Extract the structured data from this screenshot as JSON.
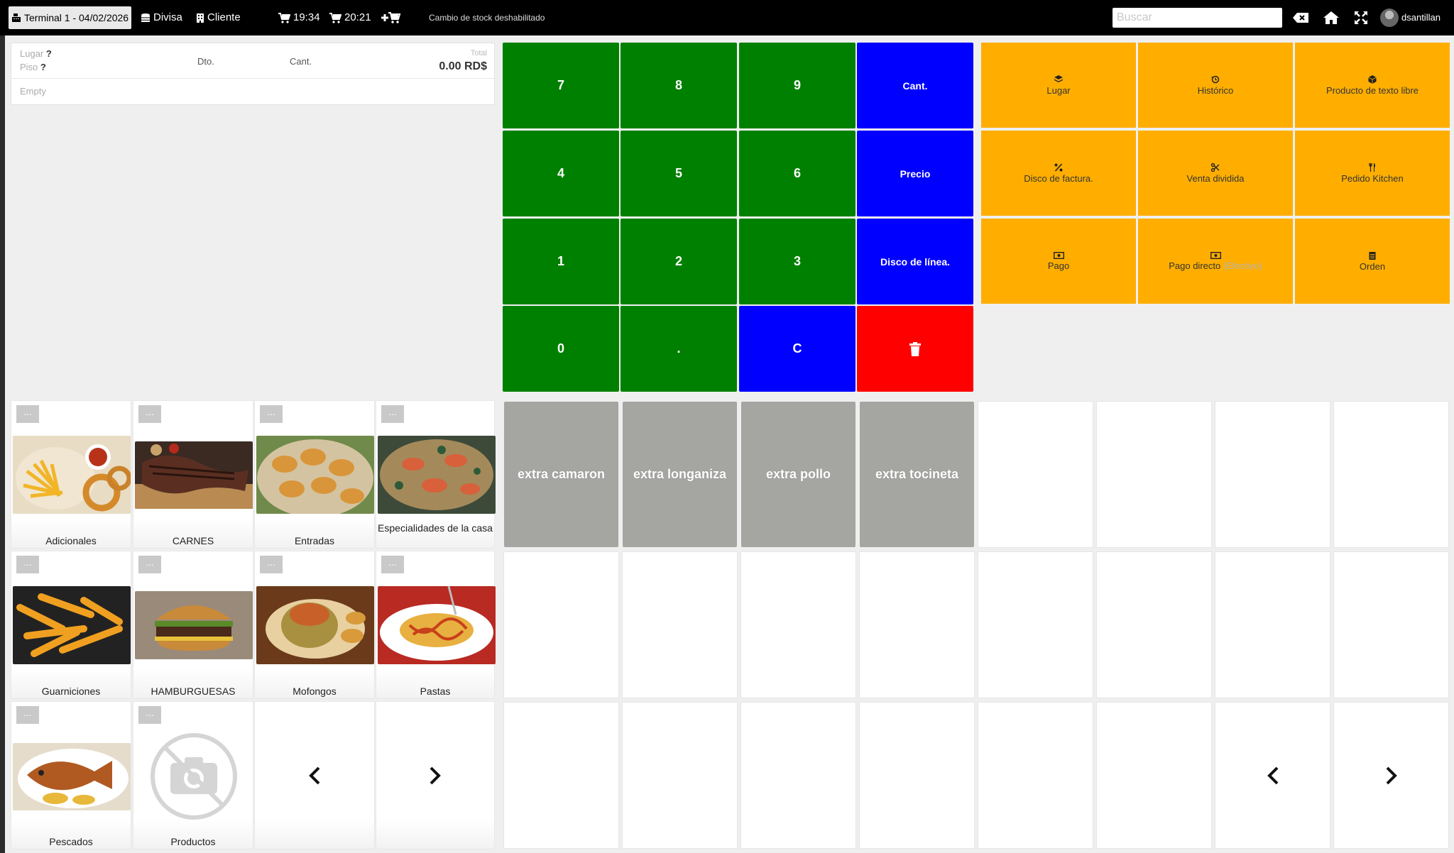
{
  "topbar": {
    "terminal": "Terminal 1 - 04/02/2026",
    "currency": "Divisa",
    "customer": "Cliente",
    "cart1_time": "19:34",
    "cart2_time": "20:21",
    "stock_note": "Cambio de stock deshabilitado",
    "search_placeholder": "Buscar",
    "username": "dsantillan"
  },
  "ticket": {
    "place_label": "Lugar",
    "place_value": "?",
    "floor_label": "Piso",
    "floor_value": "?",
    "discount_header": "Dto.",
    "qty_header": "Cant.",
    "total_label": "Total",
    "total_value": "0.00 RD$",
    "empty_text": "Empty"
  },
  "numpad": {
    "keys": [
      "7",
      "8",
      "9",
      "4",
      "5",
      "6",
      "1",
      "2",
      "3",
      "0",
      ".",
      "C"
    ],
    "qty_label": "Cant.",
    "price_label": "Precio",
    "line_discount_label": "Disco de línea."
  },
  "actions": [
    {
      "icon": "layers-icon",
      "label": "Lugar"
    },
    {
      "icon": "history-icon",
      "label": "Histórico"
    },
    {
      "icon": "cube-icon",
      "label": "Producto de texto libre"
    },
    {
      "icon": "percent-icon",
      "label": "Disco de factura."
    },
    {
      "icon": "scissors-icon",
      "label": "Venta dividida"
    },
    {
      "icon": "utensils-icon",
      "label": "Pedido Kitchen"
    },
    {
      "icon": "cash-icon",
      "label": "Pago"
    },
    {
      "icon": "cash-icon",
      "label": "Pago directo",
      "suffix": "(Efectivo)"
    },
    {
      "icon": "clipboard-icon",
      "label": "Orden"
    }
  ],
  "categories": [
    {
      "label": "Adicionales",
      "dots": "..."
    },
    {
      "label": "CARNES",
      "dots": "..."
    },
    {
      "label": "Entradas",
      "dots": "..."
    },
    {
      "label": "Especialidades de la casa",
      "dots": "..."
    },
    {
      "label": "Guarniciones",
      "dots": "..."
    },
    {
      "label": "HAMBURGUESAS",
      "dots": "..."
    },
    {
      "label": "Mofongos",
      "dots": "..."
    },
    {
      "label": "Pastas",
      "dots": "..."
    },
    {
      "label": "Pescados",
      "dots": "..."
    },
    {
      "label": "Productos",
      "dots": "..."
    }
  ],
  "products": [
    {
      "label": "extra camaron"
    },
    {
      "label": "extra longaniza"
    },
    {
      "label": "extra pollo"
    },
    {
      "label": "extra tocineta"
    }
  ],
  "colors": {
    "numpad_green": "#008000",
    "numpad_blue": "#0000ff",
    "delete_red": "#ff0000",
    "action_orange": "#ffae00",
    "product_gray": "#a5a5a2"
  }
}
